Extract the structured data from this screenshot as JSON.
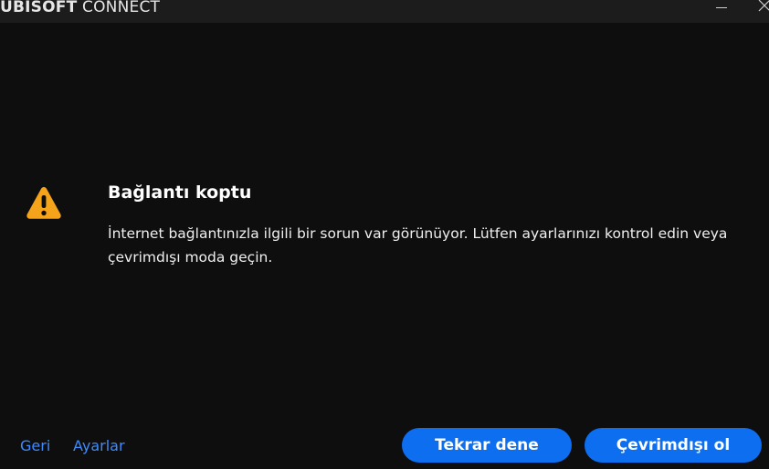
{
  "titlebar": {
    "brand": "UBISOFT",
    "product": "CONNECT",
    "icons": {
      "minimize": "minimize-icon",
      "close": "close-icon"
    }
  },
  "dialog": {
    "icon": "warning-icon",
    "icon_color": "#f5a31a",
    "title": "Bağlantı koptu",
    "message": "İnternet bağlantınızla ilgili bir sorun var görünüyor. Lütfen ayarlarınızı kontrol edin veya çevrimdışı moda geçin."
  },
  "footer": {
    "back_label": "Geri",
    "settings_label": "Ayarlar",
    "retry_label": "Tekrar dene",
    "offline_label": "Çevrimdışı ol"
  },
  "colors": {
    "background": "#0e0e0f",
    "titlebar": "#1c1c1d",
    "accent": "#0d6ef0",
    "link": "#3d8bff"
  }
}
